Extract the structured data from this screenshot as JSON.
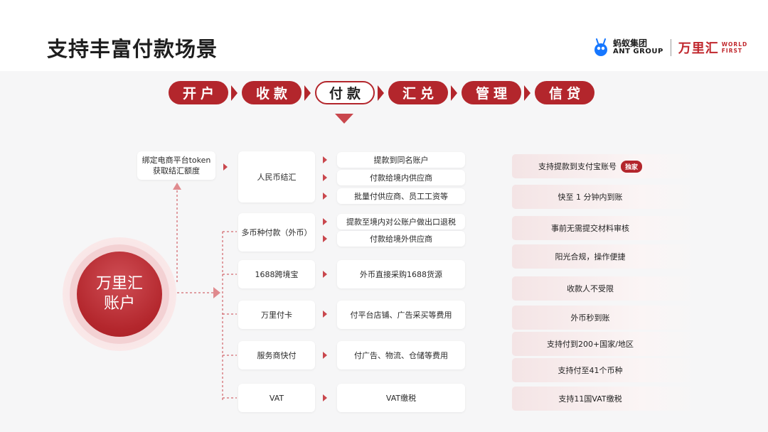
{
  "title": "支持丰富付款场景",
  "logo": {
    "ant_cn": "蚂蚁集团",
    "ant_en": "ANT GROUP",
    "wf_cn": "万里汇",
    "wf_en_1": "WORLD",
    "wf_en_2": "FIRST"
  },
  "tabs": [
    {
      "label": "开户",
      "active": false
    },
    {
      "label": "收款",
      "active": false
    },
    {
      "label": "付款",
      "active": true
    },
    {
      "label": "汇兑",
      "active": false
    },
    {
      "label": "管理",
      "active": false
    },
    {
      "label": "信贷",
      "active": false
    }
  ],
  "token_card": {
    "line1": "绑定电商平台token",
    "line2": "获取结汇额度"
  },
  "account": {
    "line1": "万里汇",
    "line2": "账户"
  },
  "categories": [
    {
      "label": "人民币结汇",
      "items": [
        "提款到同名账户",
        "付款给境内供应商",
        "批量付供应商、员工工资等"
      ]
    },
    {
      "label": "多币种付款（外币）",
      "items": [
        "提款至境内对公账户做出口退税",
        "付款给境外供应商"
      ]
    },
    {
      "label": "1688跨境宝",
      "items": [
        "外币直接采购1688货源"
      ]
    },
    {
      "label": "万里付卡",
      "items": [
        "付平台店铺、广告采买等费用"
      ]
    },
    {
      "label": "服务商快付",
      "items": [
        "付广告、物流、仓储等费用"
      ]
    },
    {
      "label": "VAT",
      "items": [
        "VAT缴税"
      ]
    }
  ],
  "features": [
    {
      "text": "支持提款到支付宝账号",
      "badge": "独家"
    },
    {
      "text": "快至 1 分钟内到账"
    },
    {
      "text": "事前无需提交材料审核"
    },
    {
      "text": "阳光合规，操作便捷"
    },
    {
      "text": "收款人不受限"
    },
    {
      "text": "外币秒到账"
    },
    {
      "text": "支持付到200+国家/地区"
    },
    {
      "text": "支持付至41个币种"
    },
    {
      "text": "支持11国VAT缴税"
    }
  ],
  "colors": {
    "brand": "#b3262c",
    "accent_light": "#f4e4e5"
  }
}
